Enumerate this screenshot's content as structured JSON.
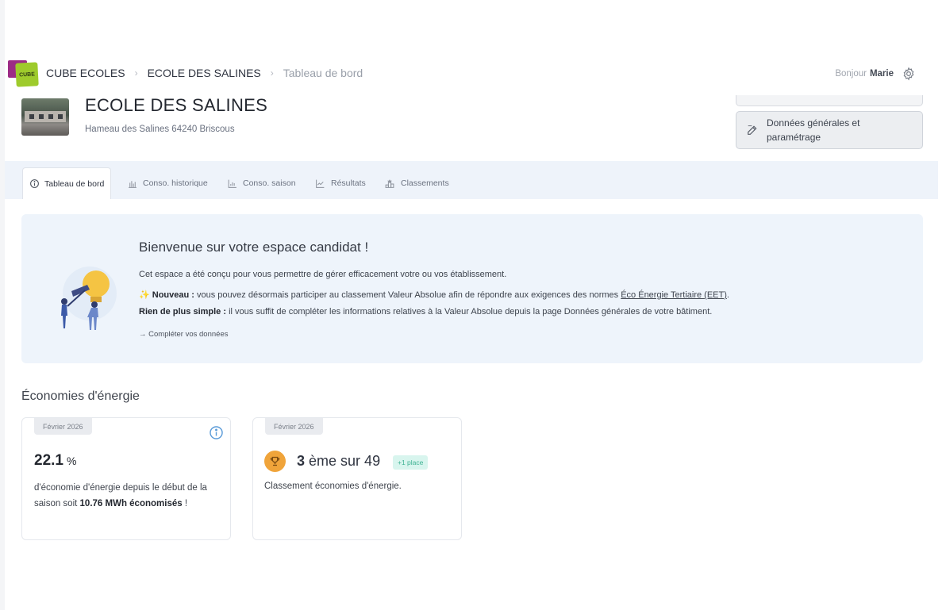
{
  "breadcrumb": {
    "logo_text": "CUBE",
    "items": [
      "CUBE ECOLES",
      "ECOLE DES SALINES",
      "Tableau de bord"
    ],
    "separator": "›"
  },
  "user": {
    "greeting": "Bonjour",
    "name": "Marie"
  },
  "school": {
    "name": "ECOLE DES SALINES",
    "address": "Hameau des Salines 64240 Briscous"
  },
  "actions": {
    "params_label": "Données générales et paramétrage"
  },
  "tabs": [
    {
      "label": "Tableau de bord",
      "icon": "info-circle-icon",
      "active": true
    },
    {
      "label": "Conso. historique",
      "icon": "bar-chart-icon",
      "active": false
    },
    {
      "label": "Conso. saison",
      "icon": "column-chart-icon",
      "active": false
    },
    {
      "label": "Résultats",
      "icon": "line-chart-icon",
      "active": false
    },
    {
      "label": "Classements",
      "icon": "podium-icon",
      "active": false
    }
  ],
  "welcome": {
    "title": "Bienvenue sur votre espace candidat !",
    "intro": "Cet espace a été conçu pour vous permettre de gérer efficacement votre ou vos établissement.",
    "new_prefix": "✨",
    "new_label": "Nouveau :",
    "new_text": " vous pouvez désormais participer au classement Valeur Absolue afin de répondre aux exigences des normes ",
    "new_link": "Éco Énergie Tertiaire (EET)",
    "new_suffix": ".",
    "simple_label": "Rien de plus simple :",
    "simple_text": " il vous suffit de compléter les informations relatives à la Valeur Absolue depuis la page Données générales de votre bâtiment.",
    "cta": "→ Compléter vos données"
  },
  "energy": {
    "section_title": "Économies d'énergie",
    "savings_card": {
      "period": "Février 2026",
      "value": "22.1",
      "unit": "%",
      "text_before": "d'économie d'énergie depuis le début de la saison soit ",
      "amount": "10.76 MWh économisés",
      "text_after": " !"
    },
    "ranking_card": {
      "period": "Février 2026",
      "rank": "3",
      "rank_text": "ème sur 49",
      "change": "+1 place",
      "label": "Classement économies d'énergie."
    }
  },
  "colors": {
    "tab_bar_bg": "#eef3fa",
    "welcome_bg": "#eef4fb",
    "trophy": "#f0a43a",
    "badge_up_bg": "#d8f5ee",
    "badge_up_text": "#3fb293",
    "info_icon": "#5a9bd8",
    "logo_green": "#9ecb2c",
    "logo_purple": "#9c2b86"
  }
}
